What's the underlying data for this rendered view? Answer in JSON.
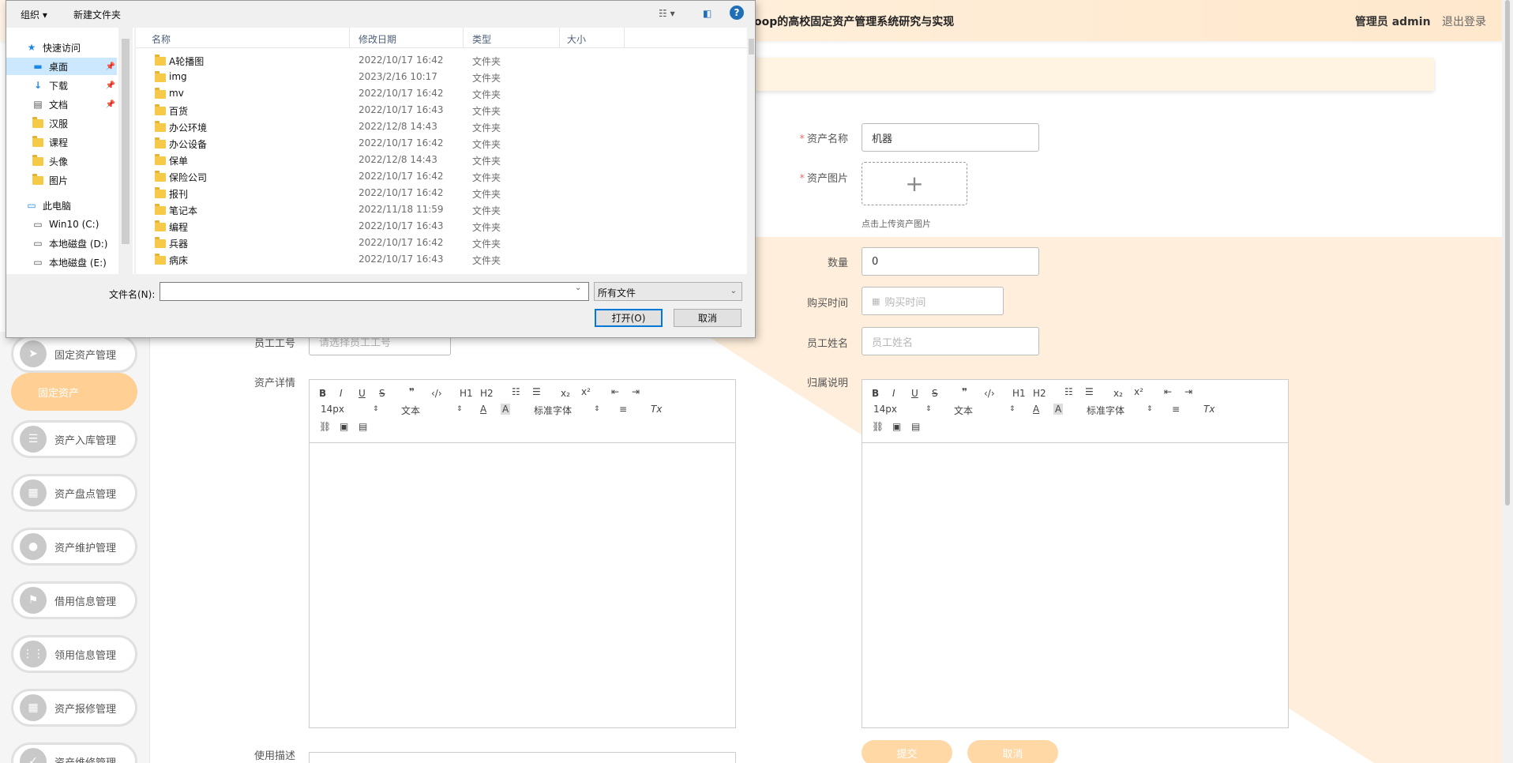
{
  "app": {
    "title": "oop的高校固定资产管理系统研究与实现",
    "user": "管理员 admin",
    "logout": "退出登录"
  },
  "sidebar": {
    "items": [
      {
        "label": "固定资产管理",
        "icon": "send-icon"
      },
      {
        "label": "固定资产",
        "icon": ""
      },
      {
        "label": "资产入库管理",
        "icon": "sliders-icon"
      },
      {
        "label": "资产盘点管理",
        "icon": "grid-icon"
      },
      {
        "label": "资产维护管理",
        "icon": "user-icon"
      },
      {
        "label": "借用信息管理",
        "icon": "flag-icon"
      },
      {
        "label": "领用信息管理",
        "icon": "apps-icon"
      },
      {
        "label": "资产报修管理",
        "icon": "grid-icon"
      },
      {
        "label": "资产维修管理",
        "icon": "check-icon"
      }
    ]
  },
  "form": {
    "asset_name_label": "资产名称",
    "asset_name_value": "机器",
    "asset_image_label": "资产图片",
    "upload_plus": "+",
    "upload_tip": "点击上传资产图片",
    "quantity_label": "数量",
    "quantity_value": "0",
    "purchase_time_label": "购买时间",
    "purchase_time_placeholder": "购买时间",
    "staff_name_label": "员工姓名",
    "staff_name_placeholder": "员工姓名",
    "staff_no_label": "员工工号",
    "staff_no_placeholder": "请选择员工工号",
    "detail_label": "资产详情",
    "ownership_label": "归属说明",
    "usage_label": "使用描述",
    "submit": "提交",
    "cancel": "取消"
  },
  "editor": {
    "size": "14px",
    "text": "文本",
    "font": "标准字体",
    "h1": "H1",
    "h2": "H2",
    "sub": "x₂",
    "sup": "x²"
  },
  "dialog": {
    "toolbar": {
      "organize": "组织 ▾",
      "new_folder": "新建文件夹"
    },
    "nav": [
      {
        "label": "快速访问",
        "type": "star"
      },
      {
        "label": "桌面",
        "type": "desktop",
        "pinned": true
      },
      {
        "label": "下载",
        "type": "download",
        "pinned": true
      },
      {
        "label": "文档",
        "type": "doc",
        "pinned": true
      },
      {
        "label": "汉服",
        "type": "folder"
      },
      {
        "label": "课程",
        "type": "folder"
      },
      {
        "label": "头像",
        "type": "folder"
      },
      {
        "label": "图片",
        "type": "folder"
      },
      {
        "label": "此电脑",
        "type": "pc"
      },
      {
        "label": "Win10 (C:)",
        "type": "drive"
      },
      {
        "label": "本地磁盘 (D:)",
        "type": "drive"
      },
      {
        "label": "本地磁盘 (E:)",
        "type": "drive"
      }
    ],
    "columns": {
      "name": "名称",
      "date": "修改日期",
      "type": "类型",
      "size": "大小"
    },
    "files": [
      {
        "name": "A轮播图",
        "date": "2022/10/17 16:42",
        "type": "文件夹"
      },
      {
        "name": "img",
        "date": "2023/2/16 10:17",
        "type": "文件夹"
      },
      {
        "name": "mv",
        "date": "2022/10/17 16:42",
        "type": "文件夹"
      },
      {
        "name": "百货",
        "date": "2022/10/17 16:43",
        "type": "文件夹"
      },
      {
        "name": "办公环境",
        "date": "2022/12/8 14:43",
        "type": "文件夹"
      },
      {
        "name": "办公设备",
        "date": "2022/10/17 16:42",
        "type": "文件夹"
      },
      {
        "name": "保单",
        "date": "2022/12/8 14:43",
        "type": "文件夹"
      },
      {
        "name": "保险公司",
        "date": "2022/10/17 16:42",
        "type": "文件夹"
      },
      {
        "name": "报刊",
        "date": "2022/10/17 16:42",
        "type": "文件夹"
      },
      {
        "name": "笔记本",
        "date": "2022/11/18 11:59",
        "type": "文件夹"
      },
      {
        "name": "编程",
        "date": "2022/10/17 16:43",
        "type": "文件夹"
      },
      {
        "name": "兵器",
        "date": "2022/10/17 16:42",
        "type": "文件夹"
      },
      {
        "name": "病床",
        "date": "2022/10/17 16:43",
        "type": "文件夹"
      }
    ],
    "filename_label": "文件名(N):",
    "filename_value": "",
    "filetype": "所有文件",
    "open": "打开(O)",
    "cancel": "取消"
  },
  "colors": {
    "accent": "#ffcf93",
    "bg_tint": "#feeedb",
    "dialog_blue": "#0078d7"
  }
}
